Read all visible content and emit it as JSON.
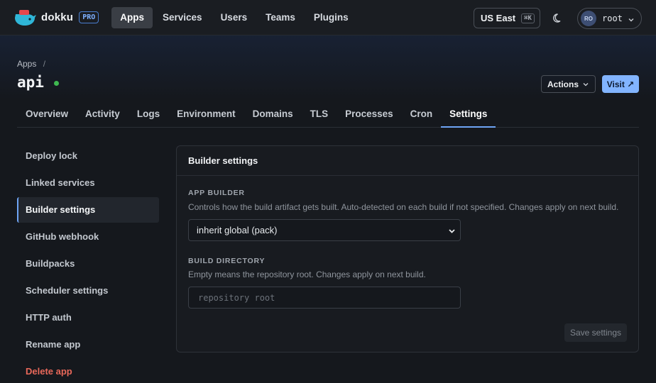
{
  "brand": {
    "name": "dokku",
    "badge": "PRO",
    "logo_color": "#2fb6d8"
  },
  "nav": {
    "items": [
      "Apps",
      "Services",
      "Users",
      "Teams",
      "Plugins"
    ],
    "active": "Apps"
  },
  "region": {
    "label": "US East",
    "shortcut": "⌘K"
  },
  "user": {
    "initials": "RO",
    "name": "root"
  },
  "breadcrumb": {
    "root": "Apps",
    "separator": "/"
  },
  "app": {
    "name": "api",
    "status_color": "#3fb950"
  },
  "header_actions": {
    "actions_label": "Actions",
    "visit_label": "Visit ↗"
  },
  "tabs": {
    "items": [
      "Overview",
      "Activity",
      "Logs",
      "Environment",
      "Domains",
      "TLS",
      "Processes",
      "Cron",
      "Settings"
    ],
    "active": "Settings"
  },
  "sidebar": {
    "items": [
      "Deploy lock",
      "Linked services",
      "Builder settings",
      "GitHub webhook",
      "Buildpacks",
      "Scheduler settings",
      "HTTP auth",
      "Rename app",
      "Delete app"
    ],
    "active": "Builder settings",
    "danger": "Delete app"
  },
  "builder": {
    "title": "Builder settings",
    "app_builder": {
      "label": "APP BUILDER",
      "help": "Controls how the build artifact gets built. Auto-detected on each build if not specified. Changes apply on next build.",
      "value": "inherit global (pack)"
    },
    "build_dir": {
      "label": "BUILD DIRECTORY",
      "help": "Empty means the repository root. Changes apply on next build.",
      "placeholder": "repository root"
    },
    "save_label": "Save settings"
  },
  "colors": {
    "accent": "#82b4ff",
    "danger": "#e8685a",
    "background": "#15181d"
  }
}
